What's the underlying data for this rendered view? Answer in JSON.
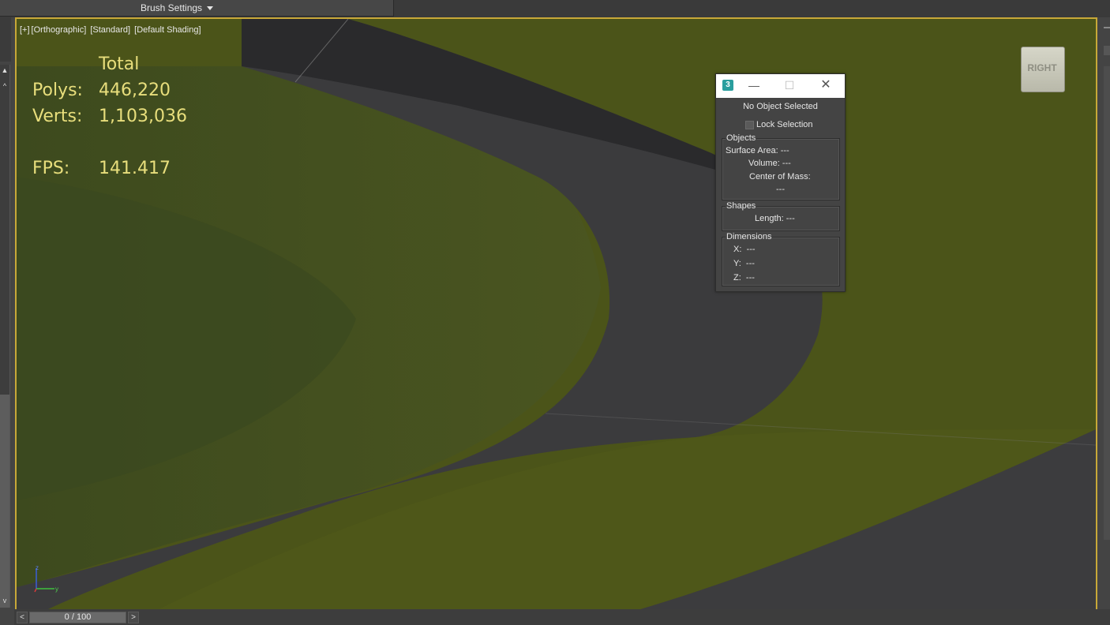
{
  "toolbar": {
    "brush_settings_label": "Brush Settings"
  },
  "viewport": {
    "labels": [
      "[+]",
      "[Orthographic]",
      "[Standard]",
      "[Default Shading]"
    ],
    "border_color": "#c8a838",
    "stats": {
      "header": "Total",
      "polys_label": "Polys:",
      "polys_value": "446,220",
      "verts_label": "Verts:",
      "verts_value": "1,103,036",
      "fps_label": "FPS:",
      "fps_value": "141.417",
      "color": "#e8de7c"
    },
    "viewcube_label": "RIGHT",
    "axis": {
      "z": "z",
      "y": "y"
    }
  },
  "measure_dialog": {
    "app_icon": "3",
    "status": "No Object Selected",
    "lock_selection": "Lock Selection",
    "objects": {
      "title": "Objects",
      "surface_area_label": "Surface Area:",
      "surface_area_value": "---",
      "volume_label": "Volume:",
      "volume_value": "---",
      "center_of_mass_label": "Center of Mass:",
      "center_of_mass_value": "---"
    },
    "shapes": {
      "title": "Shapes",
      "length_label": "Length:",
      "length_value": "---"
    },
    "dimensions": {
      "title": "Dimensions",
      "x_label": "X:",
      "x_value": "---",
      "y_label": "Y:",
      "y_value": "---",
      "z_label": "Z:",
      "z_value": "---"
    }
  },
  "timeline": {
    "prev": "<",
    "next": ">",
    "frame_display": "0 / 100"
  },
  "icons": [
    "chevron-down-icon",
    "app-icon",
    "minimize-icon",
    "maximize-icon",
    "close-icon",
    "checkbox",
    "scroll-up-icon",
    "scroll-down-icon",
    "axis-gizmo-icon",
    "viewcube"
  ]
}
